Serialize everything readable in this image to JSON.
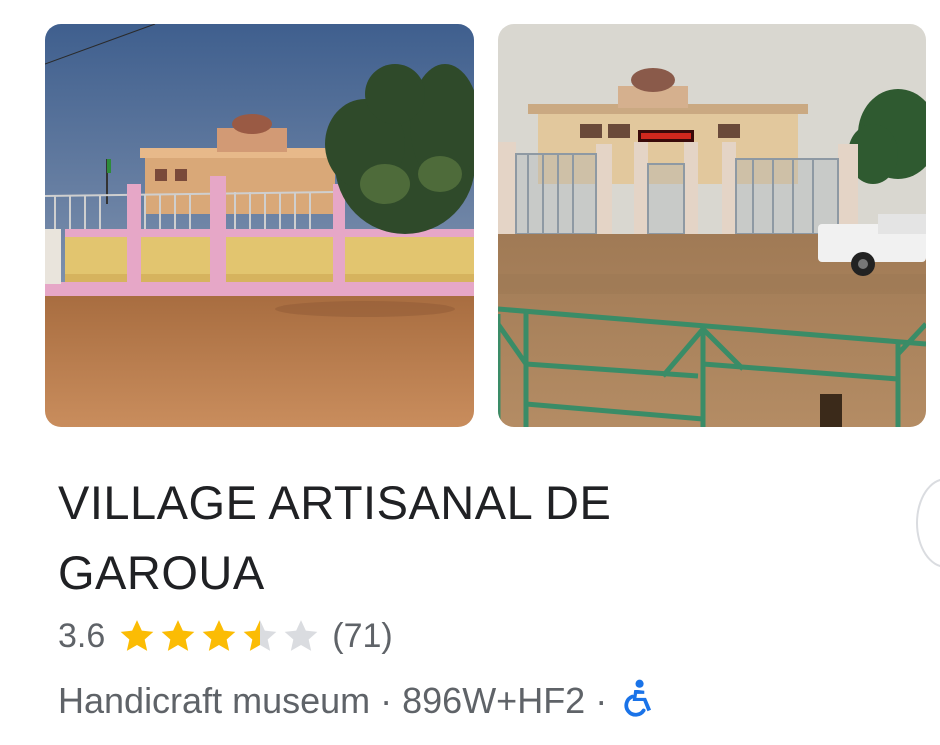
{
  "photos": [
    {
      "name": "exterior-photo-pink-wall",
      "colors": {
        "sky": "#4f6f9b",
        "wall": "#e8c870",
        "pink": "#e7a6c8",
        "ground": "#b97b4a"
      }
    },
    {
      "name": "exterior-photo-gate",
      "colors": {
        "sky": "#d8d6cf",
        "wall": "#e2c9a0",
        "gate": "#9aa6b0",
        "ground": "#a9825b",
        "fence": "#3f8f6a"
      }
    }
  ],
  "place": {
    "title_line1": "VILLAGE ARTISANAL DE",
    "title_line2": "GAROUA",
    "rating": "3.6",
    "rating_value": 3.6,
    "stars_max": 5,
    "review_count": "(71)",
    "category": "Handicraft museum",
    "separator": "·",
    "plus_code": "896W+HF2",
    "accessibility_icon": "wheelchair-icon"
  },
  "colors": {
    "star_filled": "#fbbc04",
    "star_empty": "#dadce0",
    "accessibility": "#1a73e8",
    "text_primary": "#202124",
    "text_secondary": "#5f6368"
  }
}
